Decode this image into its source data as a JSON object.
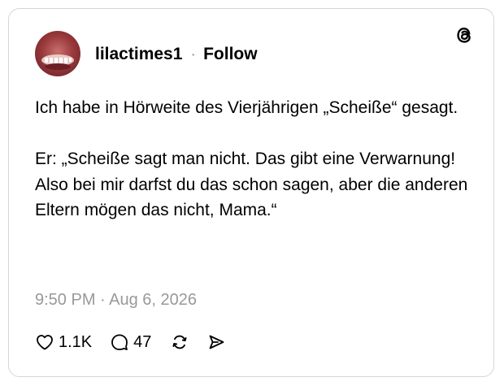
{
  "post": {
    "author": {
      "username": "lilactimes1",
      "separator": "·",
      "follow_label": "Follow",
      "avatar_icon": "avatar-photo"
    },
    "platform_icon": "threads-logo-icon",
    "text": {
      "line1": "Ich habe in Hörweite des Vierjährigen „Scheiße“ gesagt.",
      "line2": "Er: „Scheiße sagt man nicht. Das gibt eine Verwarnung! Also bei mir darfst du das schon sagen, aber die anderen Eltern mögen das nicht, Mama.“"
    },
    "timestamp": "9:50 PM · Aug 6, 2026",
    "actions": {
      "likes": "1.1K",
      "replies": "47",
      "like_icon": "heart-icon",
      "reply_icon": "comment-bubble-icon",
      "repost_icon": "repost-icon",
      "share_icon": "send-icon"
    }
  },
  "colors": {
    "text": "#000000",
    "muted": "#999999",
    "border": "#d6d6d6",
    "background": "#ffffff"
  }
}
